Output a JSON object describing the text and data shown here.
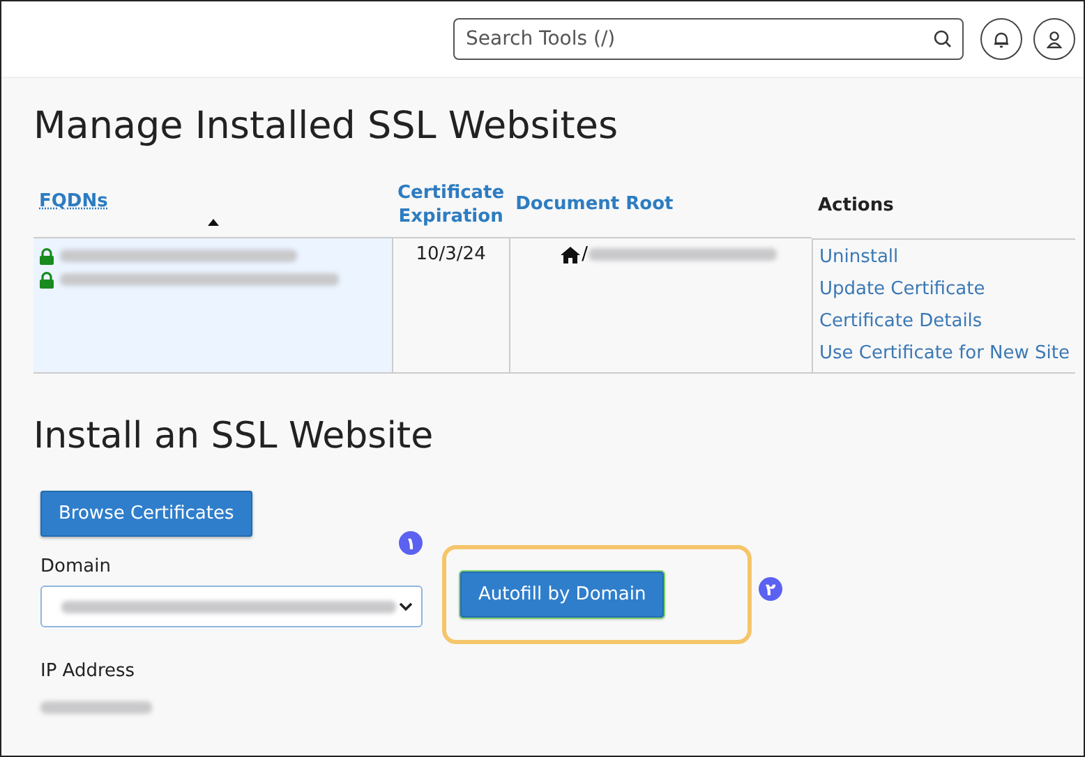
{
  "header": {
    "search": {
      "placeholder": "Search Tools (/)"
    }
  },
  "manage": {
    "title": "Manage Installed SSL Websites",
    "columns": [
      {
        "label": "FQDNs",
        "link": true,
        "sorted": true
      },
      {
        "label": "Certificate Expiration",
        "link": true,
        "sorted": false
      },
      {
        "label": "Document Root",
        "link": true,
        "sorted": false
      },
      {
        "label": "Actions",
        "link": false,
        "sorted": false
      }
    ],
    "rows": [
      {
        "expiration": "10/3/24",
        "document_root_prefix": "/",
        "actions": [
          "Uninstall",
          "Update Certificate",
          "Certificate Details",
          "Use Certificate for New Site"
        ]
      }
    ]
  },
  "install": {
    "title": "Install an SSL Website",
    "browse_button": "Browse Certificates",
    "domain_label": "Domain",
    "autofill_button": "Autofill by Domain",
    "autofill_highlighted": true,
    "ip_label": "IP Address",
    "annotations": [
      {
        "label": "۱"
      },
      {
        "label": "۲"
      }
    ]
  }
}
